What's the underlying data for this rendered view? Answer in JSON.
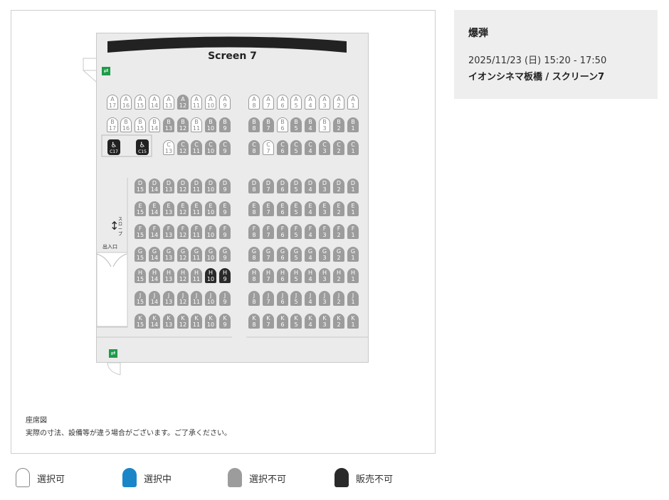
{
  "screen_name": "Screen 7",
  "movie": {
    "title": "爆弾",
    "datetime": "2025/11/23 (日) 15:20 - 17:50",
    "theater": "イオンシネマ板橋  /  スクリーン7"
  },
  "map": {
    "slope_arrow": "↕",
    "slope_label": "スロープ",
    "entrance_label": "出入口",
    "exit_symbol": "⇄",
    "wheelchair_symbol": "♿",
    "caption_title": "座席図",
    "caption_note": "実際の寸法、設備等が違う場合がございます。ご了承ください。"
  },
  "legend": [
    {
      "label": "選択可",
      "color": "#ffffff",
      "border": "#888888"
    },
    {
      "label": "選択中",
      "color": "#1a86c8",
      "border": "#1a86c8"
    },
    {
      "label": "選択不可",
      "color": "#9c9c9c",
      "border": "#9c9c9c"
    },
    {
      "label": "販売不可",
      "color": "#2a2a2a",
      "border": "#2a2a2a"
    }
  ],
  "seat_rows": [
    {
      "row": "A",
      "left": [
        [
          "17",
          "a"
        ],
        [
          "16",
          "a"
        ],
        [
          "15",
          "a"
        ],
        [
          "14",
          "a"
        ],
        [
          "13",
          "a"
        ],
        [
          "12",
          "u"
        ],
        [
          "11",
          "a"
        ],
        [
          "10",
          "a"
        ],
        [
          "9",
          "a"
        ]
      ],
      "right": [
        [
          "8",
          "a"
        ],
        [
          "7",
          "a"
        ],
        [
          "6",
          "a"
        ],
        [
          "5",
          "a"
        ],
        [
          "4",
          "a"
        ],
        [
          "3",
          "a"
        ],
        [
          "2",
          "a"
        ],
        [
          "1",
          "a"
        ]
      ]
    },
    {
      "row": "B",
      "left": [
        [
          "17",
          "a"
        ],
        [
          "16",
          "a"
        ],
        [
          "15",
          "a"
        ],
        [
          "14",
          "a"
        ],
        [
          "13",
          "u"
        ],
        [
          "12",
          "u"
        ],
        [
          "11",
          "a"
        ],
        [
          "10",
          "u"
        ],
        [
          "9",
          "u"
        ]
      ],
      "right": [
        [
          "8",
          "u"
        ],
        [
          "7",
          "u"
        ],
        [
          "6",
          "a"
        ],
        [
          "5",
          "u"
        ],
        [
          "4",
          "u"
        ],
        [
          "3",
          "a"
        ],
        [
          "2",
          "u"
        ],
        [
          "1",
          "u"
        ]
      ]
    },
    {
      "row": "C",
      "left": [
        [
          "13",
          "a"
        ],
        [
          "12",
          "u"
        ],
        [
          "11",
          "u"
        ],
        [
          "10",
          "u"
        ],
        [
          "9",
          "u"
        ]
      ],
      "right": [
        [
          "8",
          "u"
        ],
        [
          "7",
          "a"
        ],
        [
          "6",
          "u"
        ],
        [
          "5",
          "u"
        ],
        [
          "4",
          "u"
        ],
        [
          "3",
          "u"
        ],
        [
          "2",
          "u"
        ],
        [
          "1",
          "u"
        ]
      ]
    },
    {
      "row": "D",
      "left": [
        [
          "15",
          "u"
        ],
        [
          "14",
          "u"
        ],
        [
          "13",
          "u"
        ],
        [
          "12",
          "u"
        ],
        [
          "11",
          "u"
        ],
        [
          "10",
          "u"
        ],
        [
          "9",
          "u"
        ]
      ],
      "right": [
        [
          "8",
          "u"
        ],
        [
          "7",
          "u"
        ],
        [
          "6",
          "u"
        ],
        [
          "5",
          "u"
        ],
        [
          "4",
          "u"
        ],
        [
          "3",
          "u"
        ],
        [
          "2",
          "u"
        ],
        [
          "1",
          "u"
        ]
      ]
    },
    {
      "row": "E",
      "left": [
        [
          "15",
          "u"
        ],
        [
          "14",
          "u"
        ],
        [
          "13",
          "u"
        ],
        [
          "12",
          "u"
        ],
        [
          "11",
          "u"
        ],
        [
          "10",
          "u"
        ],
        [
          "9",
          "u"
        ]
      ],
      "right": [
        [
          "8",
          "u"
        ],
        [
          "7",
          "u"
        ],
        [
          "6",
          "u"
        ],
        [
          "5",
          "u"
        ],
        [
          "4",
          "u"
        ],
        [
          "3",
          "u"
        ],
        [
          "2",
          "u"
        ],
        [
          "1",
          "u"
        ]
      ]
    },
    {
      "row": "F",
      "left": [
        [
          "15",
          "u"
        ],
        [
          "14",
          "u"
        ],
        [
          "13",
          "u"
        ],
        [
          "12",
          "u"
        ],
        [
          "11",
          "u"
        ],
        [
          "10",
          "u"
        ],
        [
          "9",
          "u"
        ]
      ],
      "right": [
        [
          "8",
          "u"
        ],
        [
          "7",
          "u"
        ],
        [
          "6",
          "u"
        ],
        [
          "5",
          "u"
        ],
        [
          "4",
          "u"
        ],
        [
          "3",
          "u"
        ],
        [
          "2",
          "u"
        ],
        [
          "1",
          "u"
        ]
      ]
    },
    {
      "row": "G",
      "left": [
        [
          "15",
          "u"
        ],
        [
          "14",
          "u"
        ],
        [
          "13",
          "u"
        ],
        [
          "12",
          "u"
        ],
        [
          "11",
          "u"
        ],
        [
          "10",
          "u"
        ],
        [
          "9",
          "u"
        ]
      ],
      "right": [
        [
          "8",
          "u"
        ],
        [
          "7",
          "u"
        ],
        [
          "6",
          "u"
        ],
        [
          "5",
          "u"
        ],
        [
          "4",
          "u"
        ],
        [
          "3",
          "u"
        ],
        [
          "2",
          "u"
        ],
        [
          "1",
          "u"
        ]
      ]
    },
    {
      "row": "H",
      "left": [
        [
          "15",
          "u"
        ],
        [
          "14",
          "u"
        ],
        [
          "13",
          "u"
        ],
        [
          "12",
          "u"
        ],
        [
          "11",
          "u"
        ],
        [
          "10",
          "s"
        ],
        [
          "9",
          "s"
        ]
      ],
      "right": [
        [
          "8",
          "u"
        ],
        [
          "7",
          "u"
        ],
        [
          "6",
          "u"
        ],
        [
          "5",
          "u"
        ],
        [
          "4",
          "u"
        ],
        [
          "3",
          "u"
        ],
        [
          "2",
          "u"
        ],
        [
          "1",
          "u"
        ]
      ]
    },
    {
      "row": "J",
      "left": [
        [
          "15",
          "u"
        ],
        [
          "14",
          "u"
        ],
        [
          "13",
          "u"
        ],
        [
          "12",
          "u"
        ],
        [
          "11",
          "u"
        ],
        [
          "10",
          "u"
        ],
        [
          "9",
          "u"
        ]
      ],
      "right": [
        [
          "8",
          "u"
        ],
        [
          "7",
          "u"
        ],
        [
          "6",
          "u"
        ],
        [
          "5",
          "u"
        ],
        [
          "4",
          "u"
        ],
        [
          "3",
          "u"
        ],
        [
          "2",
          "u"
        ],
        [
          "1",
          "u"
        ]
      ]
    },
    {
      "row": "K",
      "left": [
        [
          "15",
          "u"
        ],
        [
          "14",
          "u"
        ],
        [
          "13",
          "u"
        ],
        [
          "12",
          "u"
        ],
        [
          "11",
          "u"
        ],
        [
          "10",
          "u"
        ],
        [
          "9",
          "u"
        ]
      ],
      "right": [
        [
          "8",
          "u"
        ],
        [
          "7",
          "u"
        ],
        [
          "6",
          "u"
        ],
        [
          "5",
          "u"
        ],
        [
          "4",
          "u"
        ],
        [
          "3",
          "u"
        ],
        [
          "2",
          "u"
        ],
        [
          "1",
          "u"
        ]
      ]
    }
  ],
  "wheelchair_seats": [
    {
      "label": "C17",
      "status": "s"
    },
    {
      "label": "C15",
      "status": "s"
    }
  ]
}
